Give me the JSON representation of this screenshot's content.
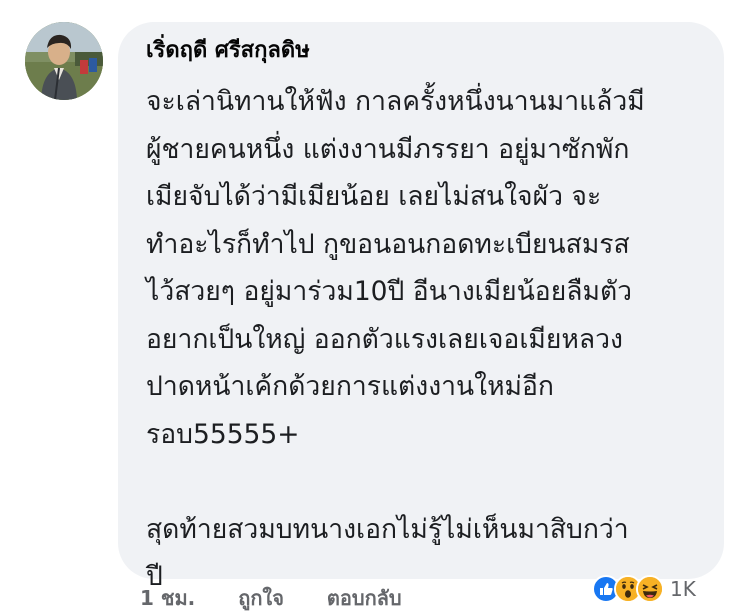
{
  "comment": {
    "author": "เริ่ดฤดี ศรีสกุลดิษ",
    "lines": [
      "จะเล่านิทานให้ฟัง กาลครั้งหนึ่งนานมาแล้วมี",
      "ผู้ชายคนหนึ่ง แต่งงานมีภรรยา อยู่มาซักพัก",
      "เมียจับได้ว่ามีเมียน้อย   เลยไม่สนใจผัว จะ",
      "ทำอะไรก็ทำไป กูขอนอนกอดทะเบียนสมรส",
      "ไว้สวยๆ อยู่มาร่วม10ปี อีนางเมียน้อยลืมตัว",
      "อยากเป็นใหญ่  ออกตัวแรงเลยเจอเมียหลวง",
      "ปาดหน้าเค้กด้วยการแต่งงานใหม่อีก",
      "รอบ55555+"
    ],
    "lines2": [
      "สุดท้ายสวมบทนางเอกไม่รู้ไม่เห็นมาสิบกว่า",
      "ปี"
    ]
  },
  "actions": {
    "time": "1 ชม.",
    "like": "ถูกใจ",
    "reply": "ตอบกลับ"
  },
  "reactions": {
    "icons": [
      "like-icon",
      "wow-icon",
      "haha-icon"
    ],
    "count": "1K",
    "colors": {
      "like": "#1877f2",
      "wow": "#f7b125",
      "haha": "#f7b125"
    }
  }
}
